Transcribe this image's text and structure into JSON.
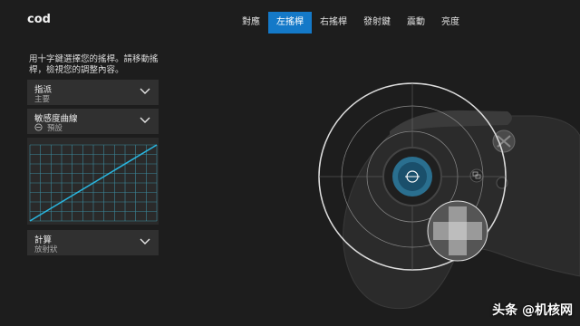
{
  "app": {
    "title": "cod"
  },
  "tabs": [
    {
      "label": "對應"
    },
    {
      "label": "左搖桿"
    },
    {
      "label": "右搖桿"
    },
    {
      "label": "發射鍵"
    },
    {
      "label": "震動"
    },
    {
      "label": "亮度"
    }
  ],
  "active_tab": "左搖桿",
  "instructions": "用十字鍵選擇您的搖桿。請移動搖桿，檢視您的調整內容。",
  "assign": {
    "label": "指派",
    "value": "主要"
  },
  "sensitivity": {
    "label": "敏感度曲線",
    "value": "預設"
  },
  "calculation": {
    "label": "計算",
    "value": "放射狀"
  },
  "curve": {
    "line_color": "#29b6e0",
    "grid_color": "#3d8a9c"
  },
  "colors": {
    "accent": "#1479c8",
    "background": "#1d1d1d",
    "panel": "#303030"
  },
  "watermark": "头条 @机核网"
}
